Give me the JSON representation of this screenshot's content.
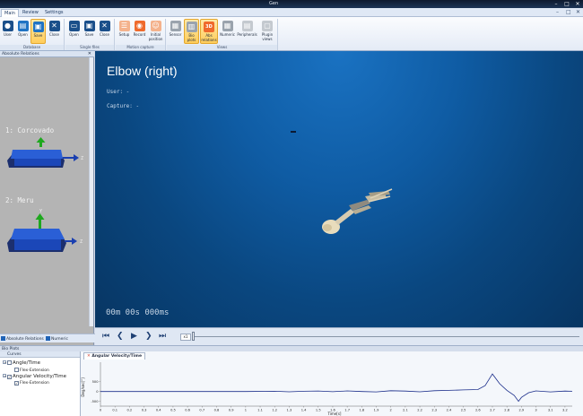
{
  "app": {
    "title": "Gen"
  },
  "menu": {
    "tabs": [
      "Main",
      "Review",
      "Settings"
    ]
  },
  "ribbon": {
    "groups": [
      {
        "label": "Database",
        "buttons": [
          {
            "label": "User",
            "icon": "user-icon"
          },
          {
            "label": "Open",
            "icon": "open-icon"
          },
          {
            "label": "Save",
            "icon": "save-icon",
            "selected": true
          },
          {
            "label": "Close",
            "icon": "close-icon"
          }
        ]
      },
      {
        "label": "Single files",
        "buttons": [
          {
            "label": "Open",
            "icon": "folder-icon"
          },
          {
            "label": "Save",
            "icon": "save-icon"
          },
          {
            "label": "Close",
            "icon": "close-icon"
          }
        ]
      },
      {
        "label": "Motion capture",
        "buttons": [
          {
            "label": "Setup",
            "icon": "setup-icon"
          },
          {
            "label": "Record",
            "icon": "record-icon"
          },
          {
            "label": "Initial position",
            "icon": "figure-icon"
          }
        ]
      },
      {
        "label": "Views",
        "buttons": [
          {
            "label": "Sensor",
            "icon": "sensor-icon"
          },
          {
            "label": "Bio plots",
            "icon": "bio-plots-icon",
            "selected": true
          },
          {
            "label": "Abs relations",
            "icon": "3d-icon",
            "selected": true
          },
          {
            "label": "Numeric",
            "icon": "grid-icon"
          },
          {
            "label": "Peripherals",
            "icon": "peripherals-icon"
          },
          {
            "label": "Plugin views",
            "icon": "plugin-icon"
          }
        ]
      }
    ]
  },
  "left_panel": {
    "title": "Absolute Relations",
    "sensors": [
      {
        "label": "1: Corcovado",
        "axis_z": "Z",
        "axis_y": "Y"
      },
      {
        "label": "2: Meru",
        "axis_z": "Z",
        "axis_y": "Y"
      }
    ],
    "tabs": [
      "Absolute Relations",
      "Numeric"
    ]
  },
  "viewport": {
    "title": "Elbow (right)",
    "user_line": "User: -",
    "capture_line": "Capture: -",
    "time": "00m 00s 000ms"
  },
  "playback": {
    "speed": "x1"
  },
  "plots": {
    "panel_title": "Bio Plots",
    "curves_header": "Curves",
    "curves": [
      {
        "label": "Angle/Time",
        "checked": false,
        "children": [
          {
            "label": "Flex-Extension",
            "checked": false
          }
        ]
      },
      {
        "label": "Angular Velocity/Time",
        "checked": true,
        "children": [
          {
            "label": "Flex-Extension",
            "checked": true
          }
        ]
      }
    ],
    "active_tab": "Angular Velocity/Time"
  },
  "chart_data": {
    "type": "line",
    "xlabel": "Time[s]",
    "ylabel": "Deg/sec[°]",
    "xlim": [
      0,
      3.25
    ],
    "ylim": [
      -750,
      1500
    ],
    "xticks": [
      "0",
      "0.1",
      "0.2",
      "0.3",
      "0.4",
      "0.5",
      "0.6",
      "0.7",
      "0.8",
      "0.9",
      "1",
      "1.1",
      "1.2",
      "1.3",
      "1.4",
      "1.5",
      "1.6",
      "1.7",
      "1.8",
      "1.9",
      "2",
      "2.1",
      "2.2",
      "2.3",
      "2.4",
      "2.5",
      "2.6",
      "2.7",
      "2.8",
      "2.9",
      "3",
      "3.1",
      "3.2"
    ],
    "yticks": [
      "500",
      "0",
      "-500"
    ],
    "grid": false,
    "series": [
      {
        "color": "#1a2d8a",
        "x": [
          0,
          0.5,
          1.0,
          1.2,
          1.3,
          1.4,
          1.5,
          1.6,
          1.7,
          1.8,
          1.9,
          2.0,
          2.1,
          2.2,
          2.3,
          2.4,
          2.5,
          2.6,
          2.65,
          2.7,
          2.75,
          2.8,
          2.85,
          2.88,
          2.9,
          2.95,
          3.0,
          3.1,
          3.2,
          3.25
        ],
        "y": [
          0,
          0,
          0,
          10,
          -15,
          10,
          25,
          -10,
          30,
          0,
          -20,
          40,
          20,
          -15,
          40,
          60,
          80,
          100,
          300,
          900,
          400,
          60,
          -200,
          -500,
          -300,
          -60,
          30,
          -20,
          20,
          10
        ]
      }
    ]
  }
}
